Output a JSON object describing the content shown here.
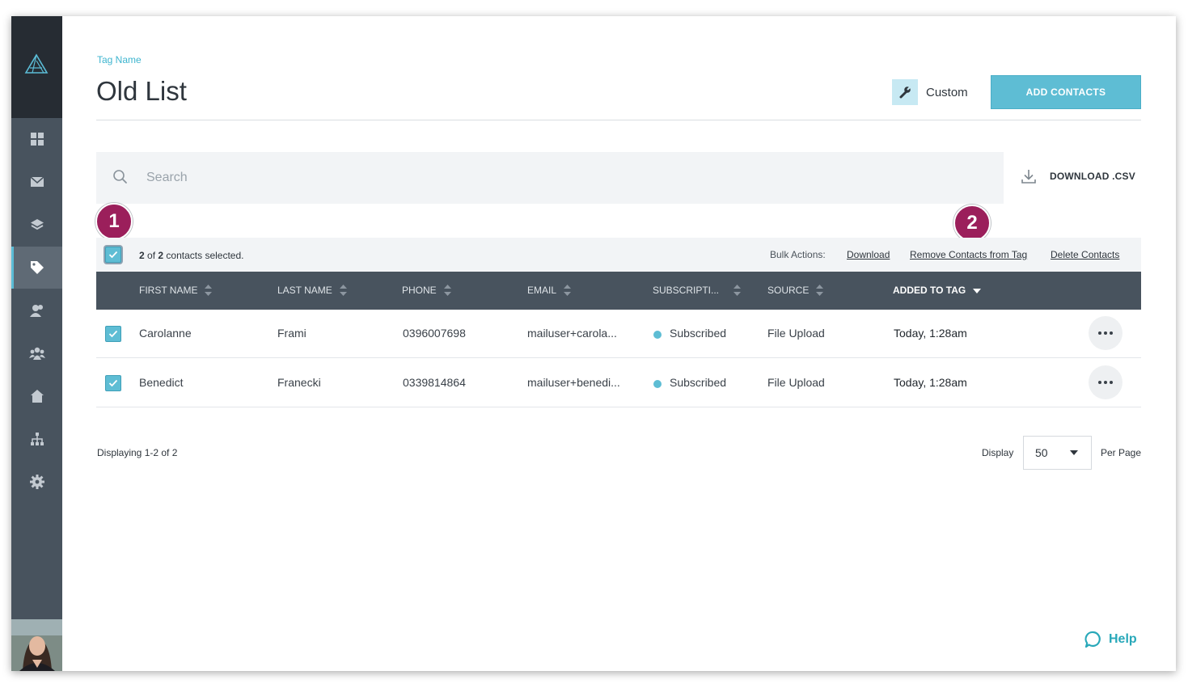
{
  "breadcrumb": "Tag Name",
  "page_title": "Old List",
  "header": {
    "custom_label": "Custom",
    "add_contacts_label": "ADD CONTACTS"
  },
  "search": {
    "placeholder": "Search"
  },
  "download_csv_label": "DOWNLOAD .CSV",
  "callouts": [
    "1",
    "2"
  ],
  "bulk": {
    "selected_count": "2",
    "of_text": "of",
    "total_count": "2",
    "suffix": "contacts selected.",
    "label": "Bulk Actions:",
    "actions": [
      "Download",
      "Remove Contacts from Tag",
      "Delete Contacts"
    ]
  },
  "table": {
    "headers": [
      "FIRST NAME",
      "LAST NAME",
      "PHONE",
      "EMAIL",
      "SUBSCRIPTI...",
      "SOURCE",
      "ADDED TO TAG"
    ],
    "rows": [
      {
        "first": "Carolanne",
        "last": "Frami",
        "phone": "0396007698",
        "email": "mailuser+carola...",
        "subscription": "Subscribed",
        "source": "File Upload",
        "added": "Today, 1:28am"
      },
      {
        "first": "Benedict",
        "last": "Franecki",
        "phone": "0339814864",
        "email": "mailuser+benedi...",
        "subscription": "Subscribed",
        "source": "File Upload",
        "added": "Today, 1:28am"
      }
    ]
  },
  "footer": {
    "displaying": "Displaying 1-2 of 2",
    "display_label": "Display",
    "per_page_value": "50",
    "per_page_label": "Per Page"
  },
  "help_label": "Help",
  "icons": {
    "sidebar": [
      "dashboard-icon",
      "mail-icon",
      "layers-icon",
      "tag-icon",
      "contacts-icon",
      "groups-icon",
      "home-icon",
      "sitemap-icon",
      "settings-icon"
    ],
    "header": [
      "wrench-icon"
    ],
    "misc": [
      "search-icon",
      "download-icon",
      "checkmark-icon",
      "sort-icon",
      "more-icon",
      "chevron-down-icon",
      "help-chat-icon"
    ]
  },
  "colors": {
    "accent": "#5ebdd4",
    "sidebar": "#48535e",
    "sidebar_top": "#262c33",
    "callout": "#9b1f5b",
    "header_row": "#48535e",
    "help": "#28a8b9"
  }
}
